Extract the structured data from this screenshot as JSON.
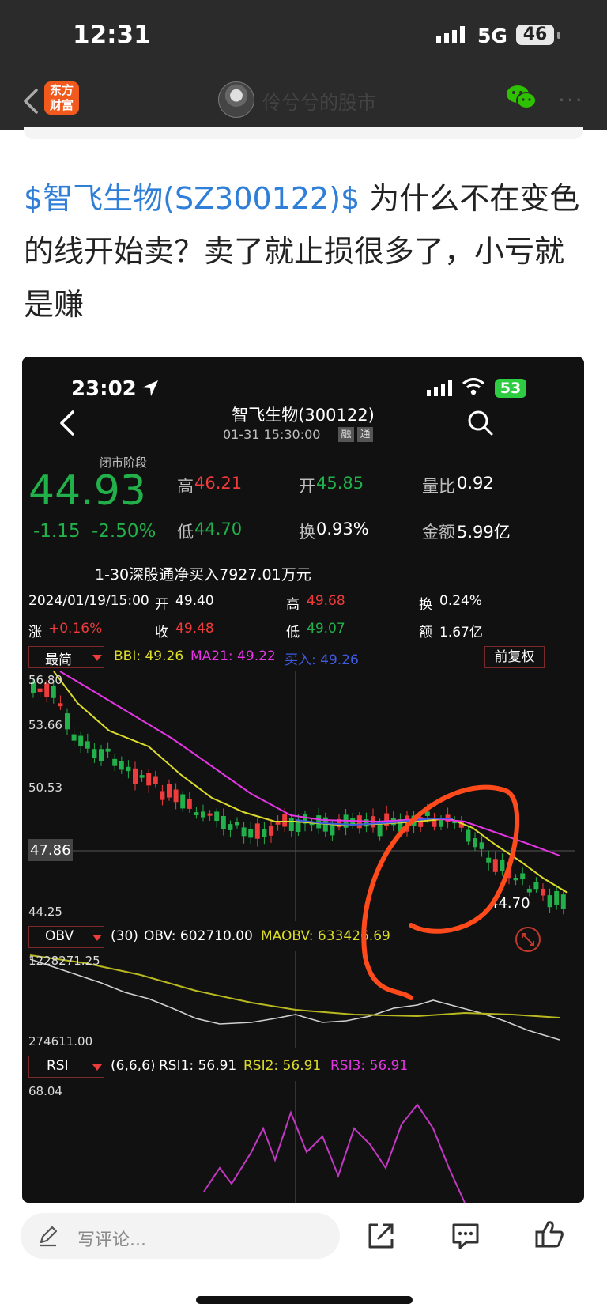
{
  "outer_status": {
    "time": "12:31",
    "network": "5G",
    "battery": "46"
  },
  "app_header": {
    "logo_text": "东方财富",
    "author_name": "伶兮兮的股市"
  },
  "post": {
    "stock_link": "$智飞生物(SZ300122)$",
    "body_text": " 为什么不在变色的线开始卖？卖了就止损很多了，小亏就是赚"
  },
  "embedded_screenshot": {
    "status": {
      "time": "23:02",
      "battery": "53"
    },
    "stock_title": "智飞生物(300122)",
    "datetime": "01-31 15:30:00",
    "tags": [
      "融",
      "通"
    ],
    "phase": "闭市阶段",
    "price": "44.93",
    "change": "-1.15",
    "change_pct": "-2.50%",
    "quote": {
      "high_label": "高",
      "high": "46.21",
      "open_label": "开",
      "open": "45.85",
      "volratio_label": "量比",
      "volratio": "0.92",
      "low_label": "低",
      "low": "44.70",
      "turnover_label": "换",
      "turnover": "0.93%",
      "amount_label": "金额",
      "amount": "5.99亿"
    },
    "northbound": "1-30深股通净买入7927.01万元",
    "candle_info": {
      "datetime": "2024/01/19/15:00",
      "open_label": "开",
      "open": "49.40",
      "high_label": "高",
      "high": "49.68",
      "turnover_label": "换",
      "turnover": "0.24%",
      "change_label": "涨",
      "change": "+0.16%",
      "close_label": "收",
      "close": "49.48",
      "low_label": "低",
      "low": "49.07",
      "amount_label": "额",
      "amount": "1.67亿"
    },
    "indicator_bar": {
      "mode": "最简",
      "bbi": "BBI: 49.26",
      "ma21": "MA21: 49.22",
      "buy": "买入: 49.26",
      "adjust": "前复权"
    },
    "price_axis": [
      "56.80",
      "53.66",
      "50.53",
      "47.86",
      "44.25"
    ],
    "last_price_label": "44.70",
    "obv_bar": {
      "mode": "OBV",
      "params": "(30)",
      "obv": "OBV: 602710.00",
      "maobv": "MAOBV: 633426.69"
    },
    "obv_axis": [
      "1228271.25",
      "274611.00"
    ],
    "rsi_bar": {
      "mode": "RSI",
      "params": "(6,6,6)",
      "rsi1": "RSI1: 56.91",
      "rsi2": "RSI2: 56.91",
      "rsi3": "RSI3: 56.91"
    },
    "rsi_axis": [
      "68.04"
    ],
    "colors": {
      "up": "#ee3b3b",
      "down": "#22b04b",
      "bbi": "#dcdc2a",
      "ma21": "#e535e5",
      "buy": "#3f5be0",
      "annotation": "#ff4a1c"
    }
  },
  "bottom_bar": {
    "comment_placeholder": "写评论..."
  }
}
